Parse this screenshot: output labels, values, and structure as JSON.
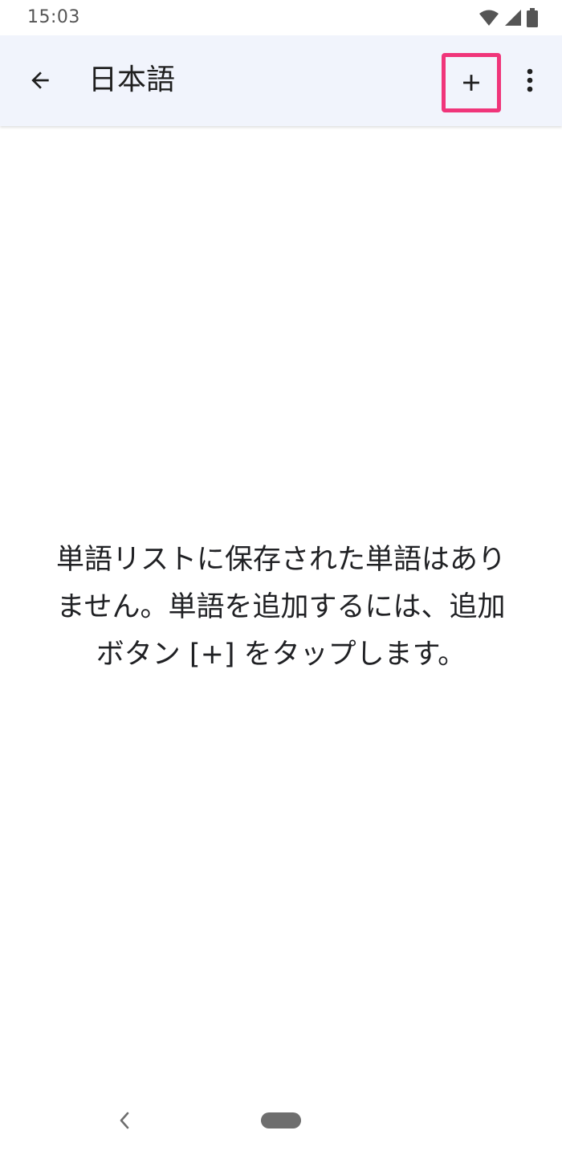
{
  "status_bar": {
    "time": "15:03",
    "icons": [
      "wifi-icon",
      "cell-signal-icon",
      "battery-icon"
    ]
  },
  "app_bar": {
    "title": "日本語",
    "back_icon": "arrow-back-icon",
    "add_icon": "plus-icon",
    "more_icon": "more-vert-icon",
    "highlight_color": "#f0357a",
    "background_color": "#f1f4fc"
  },
  "empty_state": {
    "lines": [
      "単語リストに保存された単語はあり",
      "ません。単語を追加するには、追加",
      "ボタン [+] をタップします。"
    ]
  },
  "nav_bar": {
    "back_icon": "chevron-left-icon",
    "home_icon": "home-pill-icon"
  }
}
